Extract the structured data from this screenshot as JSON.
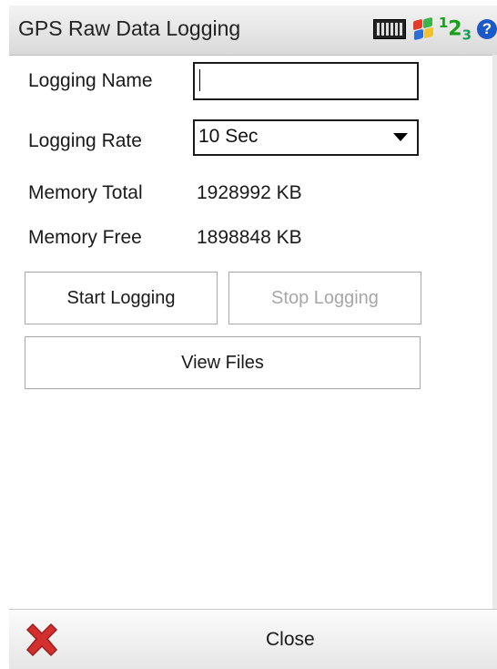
{
  "window": {
    "title": "GPS Raw Data Logging",
    "tray": {
      "keyboard_icon": "keyboard-icon",
      "start_icon": "windows-flag-icon",
      "input_mode": "1 2 3",
      "help_icon": "help-icon"
    }
  },
  "form": {
    "logging_name": {
      "label": "Logging Name",
      "value": "",
      "placeholder": ""
    },
    "logging_rate": {
      "label": "Logging Rate",
      "selected": "10 Sec"
    },
    "memory_total": {
      "label": "Memory Total",
      "value": "1928992 KB"
    },
    "memory_free": {
      "label": "Memory Free",
      "value": "1898848 KB"
    }
  },
  "buttons": {
    "start": "Start Logging",
    "stop": "Stop Logging",
    "view": "View Files"
  },
  "bottom": {
    "close_label": "Close",
    "close_icon": "red-x-icon"
  },
  "colors": {
    "help_blue": "#1b58c8",
    "ime_green": "#18a018",
    "close_red": "#d32f2f",
    "disabled_text": "#a7a7a7"
  }
}
